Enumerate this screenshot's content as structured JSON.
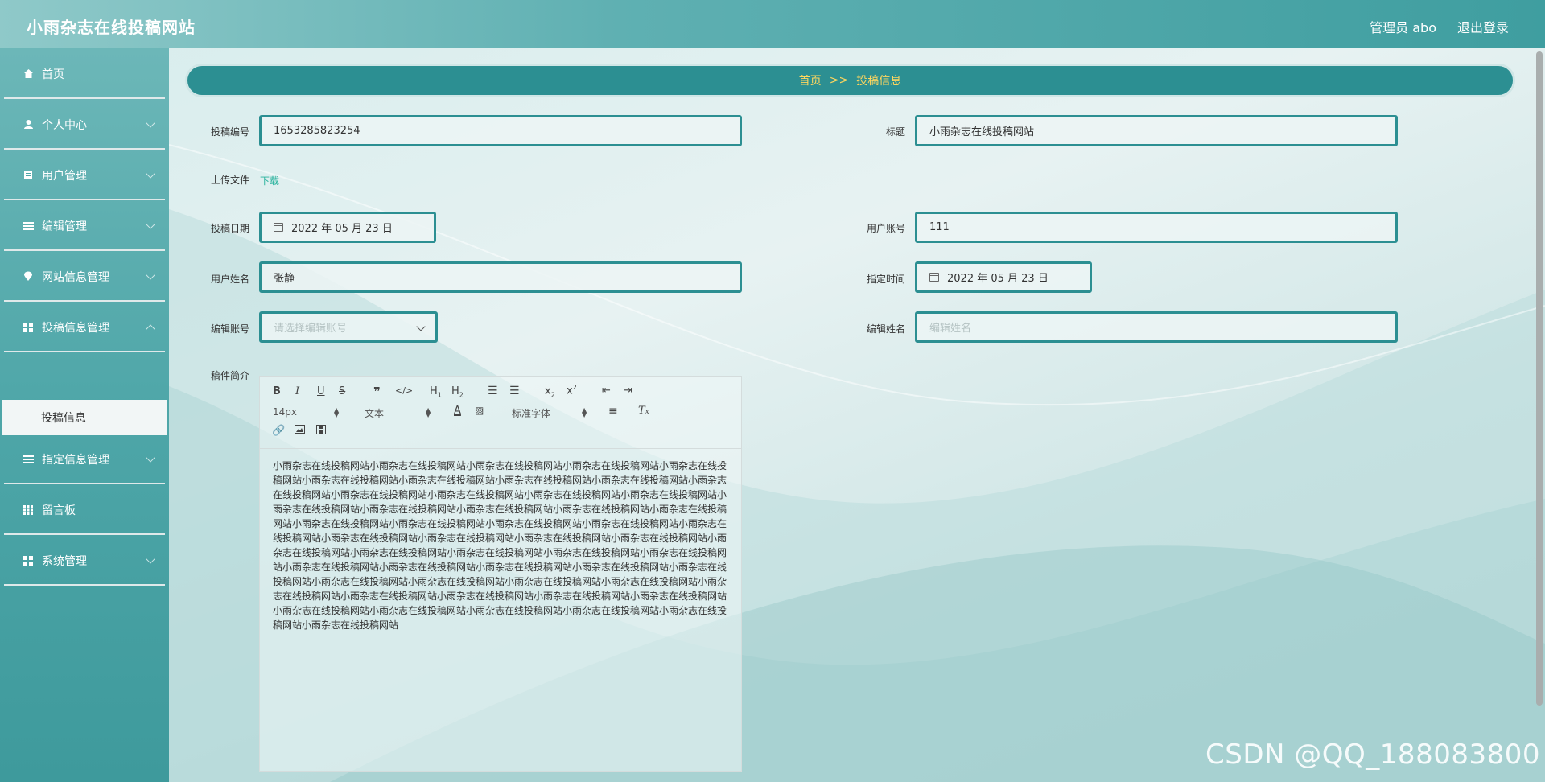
{
  "header": {
    "site_title": "小雨杂志在线投稿网站",
    "admin_label": "管理员 abo",
    "logout_label": "退出登录"
  },
  "sidebar": {
    "items": [
      {
        "label": "首页",
        "icon": "home-icon"
      },
      {
        "label": "个人中心",
        "icon": "user-icon"
      },
      {
        "label": "用户管理",
        "icon": "document-icon"
      },
      {
        "label": "编辑管理",
        "icon": "list-icon"
      },
      {
        "label": "网站信息管理",
        "icon": "location-icon"
      },
      {
        "label": "投稿信息管理",
        "icon": "grid-icon"
      },
      {
        "label": "指定信息管理",
        "icon": "list-icon"
      },
      {
        "label": "留言板",
        "icon": "grid-icon"
      },
      {
        "label": "系统管理",
        "icon": "grid-icon"
      }
    ],
    "active_subitem": "投稿信息"
  },
  "breadcrumb": {
    "home": "首页",
    "sep": ">>",
    "current": "投稿信息"
  },
  "form": {
    "submission_no_label": "投稿编号",
    "submission_no": "1653285823254",
    "title_label": "标题",
    "title": "小雨杂志在线投稿网站",
    "upload_label": "上传文件",
    "download_label": "下载",
    "date_label": "投稿日期",
    "date": "2022 年 05 月 23 日",
    "user_account_label": "用户账号",
    "user_account": "111",
    "user_name_label": "用户姓名",
    "user_name": "张静",
    "assign_time_label": "指定时间",
    "assign_time": "2022 年 05 月 23 日",
    "editor_account_label": "编辑账号",
    "editor_account_placeholder": "请选择编辑账号",
    "editor_name_label": "编辑姓名",
    "editor_name_placeholder": "编辑姓名",
    "summary_label": "稿件简介"
  },
  "editor": {
    "font_size": "14px",
    "text_type": "文本",
    "font_family": "标准字体",
    "content": "小雨杂志在线投稿网站小雨杂志在线投稿网站小雨杂志在线投稿网站小雨杂志在线投稿网站小雨杂志在线投稿网站小雨杂志在线投稿网站小雨杂志在线投稿网站小雨杂志在线投稿网站小雨杂志在线投稿网站小雨杂志在线投稿网站小雨杂志在线投稿网站小雨杂志在线投稿网站小雨杂志在线投稿网站小雨杂志在线投稿网站小雨杂志在线投稿网站小雨杂志在线投稿网站小雨杂志在线投稿网站小雨杂志在线投稿网站小雨杂志在线投稿网站小雨杂志在线投稿网站小雨杂志在线投稿网站小雨杂志在线投稿网站小雨杂志在线投稿网站小雨杂志在线投稿网站小雨杂志在线投稿网站小雨杂志在线投稿网站小雨杂志在线投稿网站小雨杂志在线投稿网站小雨杂志在线投稿网站小雨杂志在线投稿网站小雨杂志在线投稿网站小雨杂志在线投稿网站小雨杂志在线投稿网站小雨杂志在线投稿网站小雨杂志在线投稿网站小雨杂志在线投稿网站小雨杂志在线投稿网站小雨杂志在线投稿网站小雨杂志在线投稿网站小雨杂志在线投稿网站小雨杂志在线投稿网站小雨杂志在线投稿网站小雨杂志在线投稿网站小雨杂志在线投稿网站小雨杂志在线投稿网站小雨杂志在线投稿网站小雨杂志在线投稿网站小雨杂志在线投稿网站小雨杂志在线投稿网站小雨杂志在线投稿网站小雨杂志在线投稿网站小雨杂志在线投稿网站小雨杂志在线投稿网站"
  },
  "watermark": "CSDN @QQ_188083800",
  "colors": {
    "accent": "#2c8f92",
    "crumb_text": "#ffd75e",
    "link": "#2bb39e"
  }
}
